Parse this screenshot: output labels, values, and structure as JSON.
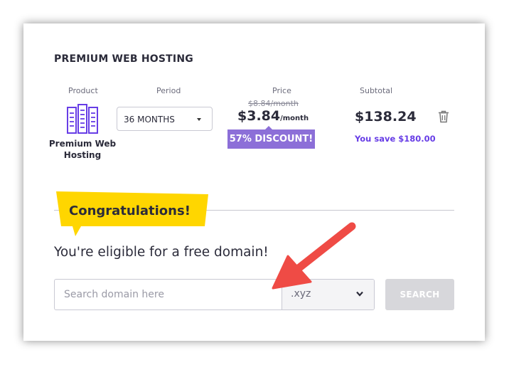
{
  "cart": {
    "title": "PREMIUM WEB HOSTING",
    "columns": {
      "product": "Product",
      "period": "Period",
      "price": "Price",
      "subtotal": "Subtotal"
    },
    "product_name": "Premium Web Hosting",
    "product_icon": "server-stack-icon",
    "period_value": "36 MONTHS",
    "old_price": "$8.84/month",
    "price_amount": "$3.84",
    "price_unit": "/month",
    "discount": "57% DISCOUNT!",
    "subtotal": "$138.24",
    "savings": "You save $180.00",
    "remove_icon": "trash-icon"
  },
  "domain": {
    "banner": "Congratulations!",
    "headline": "You're eligible for a free domain!",
    "placeholder": "Search domain here",
    "tld": ".xyz",
    "search_label": "SEARCH"
  },
  "colors": {
    "purple": "#673de6",
    "badge": "#8c6fd8",
    "banner_yellow": "#ffd600",
    "arrow_red": "#ef4b45",
    "button_disabled": "#d7d7db"
  }
}
